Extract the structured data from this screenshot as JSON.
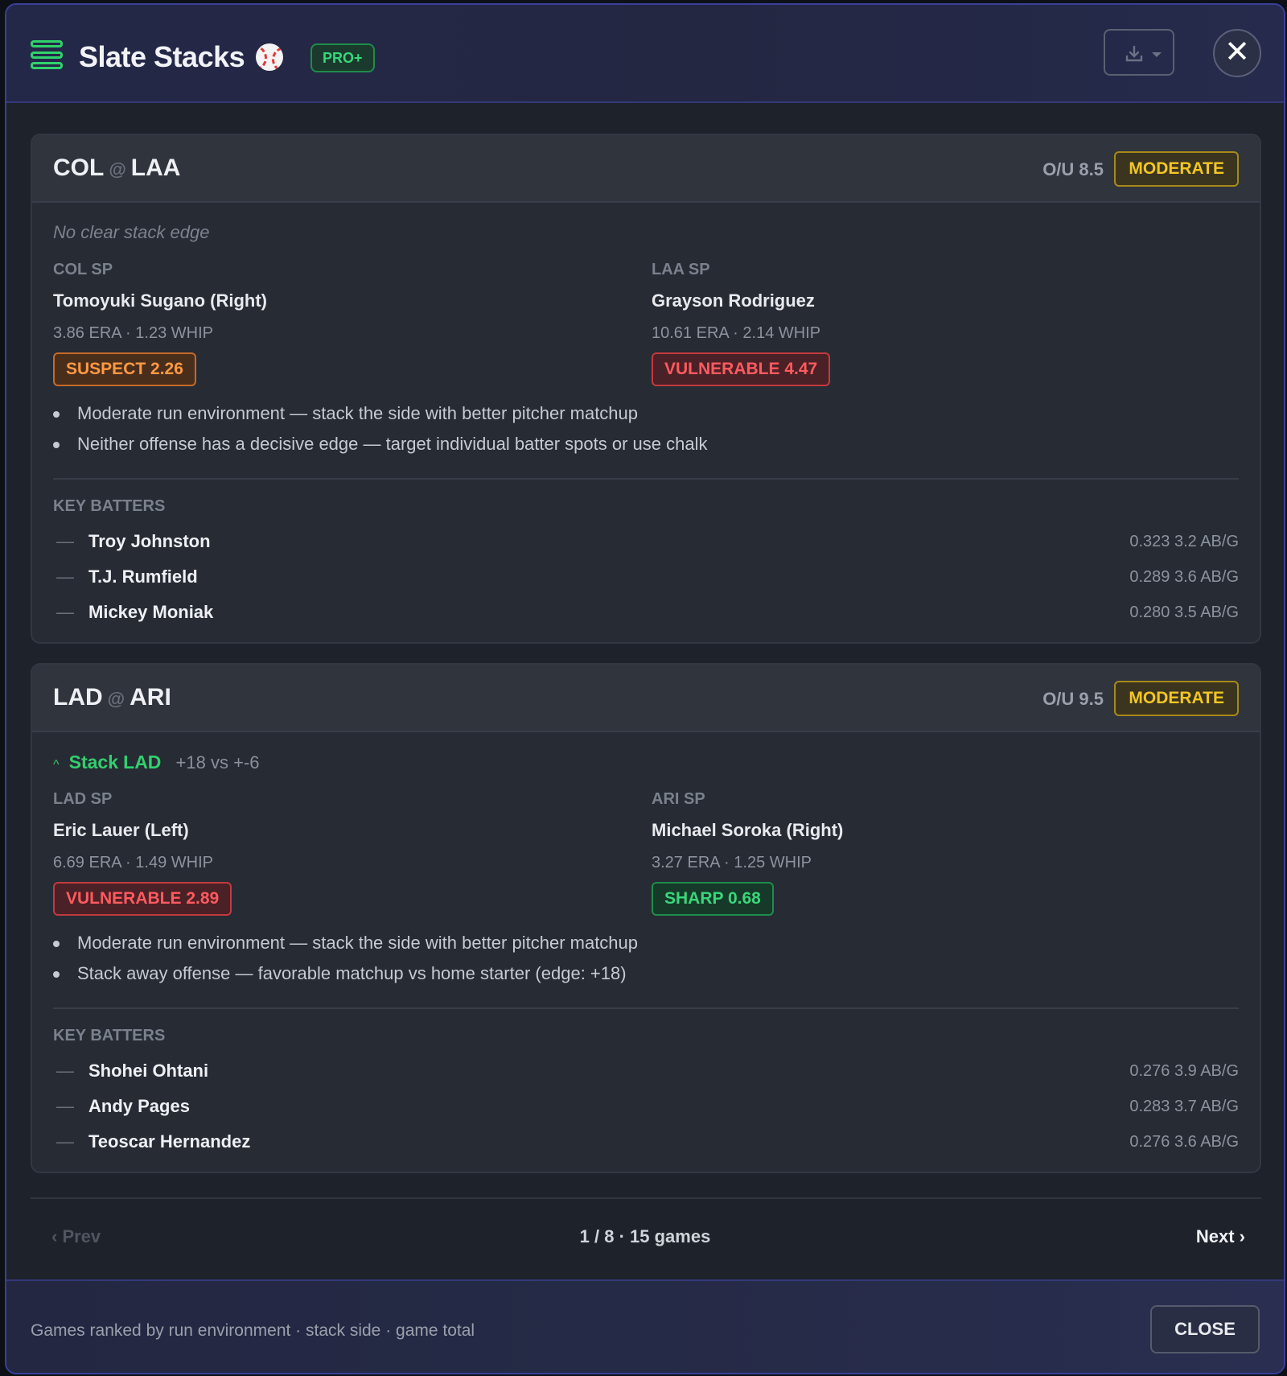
{
  "header": {
    "title": "Slate Stacks",
    "badge": "PRO+",
    "close_symbol": "✕"
  },
  "games": [
    {
      "away": "COL",
      "home": "LAA",
      "at": "@",
      "ou": "O/U 8.5",
      "env": "MODERATE",
      "edge_text": "No clear stack edge",
      "away_sp": {
        "role": "COL SP",
        "name": "Tomoyuki Sugano (Right)",
        "stats": "3.86 ERA · 1.23 WHIP",
        "rating": "SUSPECT 2.26"
      },
      "home_sp": {
        "role": "LAA SP",
        "name": "Grayson Rodriguez",
        "stats": "10.61 ERA · 2.14 WHIP",
        "rating": "VULNERABLE 4.47"
      },
      "notes": [
        "Moderate run environment — stack the side with better pitcher matchup",
        "Neither offense has a decisive edge — target individual batter spots or use chalk"
      ],
      "key_batters_title": "KEY BATTERS",
      "batters": [
        {
          "dash": "—",
          "name": "Troy Johnston",
          "stat": "0.323  3.2 AB/G"
        },
        {
          "dash": "—",
          "name": "T.J. Rumfield",
          "stat": "0.289  3.6 AB/G"
        },
        {
          "dash": "—",
          "name": "Mickey Moniak",
          "stat": "0.280  3.5 AB/G"
        }
      ]
    },
    {
      "away": "LAD",
      "home": "ARI",
      "at": "@",
      "ou": "O/U 9.5",
      "env": "MODERATE",
      "stack_chev": "^",
      "stack_label": "Stack",
      "stack_team": "LAD",
      "stack_edge": "+18 vs +-6",
      "away_sp": {
        "role": "LAD SP",
        "name": "Eric Lauer (Left)",
        "stats": "6.69 ERA · 1.49 WHIP",
        "rating": "VULNERABLE 2.89"
      },
      "home_sp": {
        "role": "ARI SP",
        "name": "Michael Soroka (Right)",
        "stats": "3.27 ERA · 1.25 WHIP",
        "rating": "SHARP 0.68"
      },
      "notes": [
        "Moderate run environment — stack the side with better pitcher matchup",
        "Stack away offense — favorable matchup vs home starter (edge: +18)"
      ],
      "key_batters_title": "KEY BATTERS",
      "batters": [
        {
          "dash": "—",
          "name": "Shohei Ohtani",
          "stat": "0.276  3.9 AB/G"
        },
        {
          "dash": "—",
          "name": "Andy Pages",
          "stat": "0.283  3.7 AB/G"
        },
        {
          "dash": "—",
          "name": "Teoscar Hernandez",
          "stat": "0.276  3.6 AB/G"
        }
      ]
    }
  ],
  "pager": {
    "prev": "‹  Prev",
    "info": "1 / 8  ·  15 games",
    "next": "Next  ›"
  },
  "footer": {
    "text": "Games ranked by run environment · stack side · game total",
    "close_label": "CLOSE"
  },
  "colors": {
    "accent_green": "#32d06d",
    "moderate": "#f3c623",
    "vulnerable": "#ff5a5f",
    "suspect": "#ff9a42"
  }
}
